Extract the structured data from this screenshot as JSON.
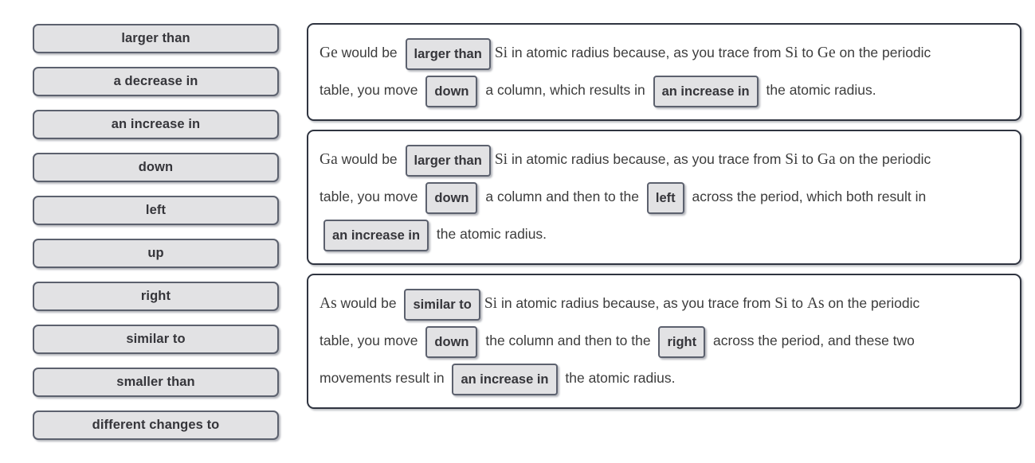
{
  "colors": {
    "page_background": "#ffffff",
    "tile_fill": "#e2e2e4",
    "tile_border": "#5c616e",
    "box_border": "#2f3440",
    "text": "#3c3c3c"
  },
  "word_bank": {
    "items": [
      {
        "label": "larger than"
      },
      {
        "label": "a decrease in"
      },
      {
        "label": "an increase in"
      },
      {
        "label": "down"
      },
      {
        "label": "left"
      },
      {
        "label": "up"
      },
      {
        "label": "right"
      },
      {
        "label": "similar to"
      },
      {
        "label": "smaller than"
      },
      {
        "label": "different changes to"
      }
    ]
  },
  "answers": [
    {
      "id": "answer-1",
      "lines": [
        {
          "parts": [
            {
              "type": "sym",
              "text": "Ge"
            },
            {
              "type": "text",
              "text": " would be "
            },
            {
              "type": "token",
              "text": "larger than"
            },
            {
              "type": "sym",
              "text": "Si"
            },
            {
              "type": "text",
              "text": " in atomic radius because, as you trace from "
            },
            {
              "type": "sym",
              "text": "Si"
            },
            {
              "type": "text",
              "text": " to "
            },
            {
              "type": "sym",
              "text": "Ge"
            },
            {
              "type": "text",
              "text": " on the periodic"
            }
          ]
        },
        {
          "parts": [
            {
              "type": "text",
              "text": "table, you move "
            },
            {
              "type": "token",
              "text": "down"
            },
            {
              "type": "text",
              "text": " a column, which results in "
            },
            {
              "type": "token",
              "text": "an increase in"
            },
            {
              "type": "text",
              "text": " the atomic radius."
            }
          ]
        }
      ]
    },
    {
      "id": "answer-2",
      "lines": [
        {
          "parts": [
            {
              "type": "sym",
              "text": "Ga"
            },
            {
              "type": "text",
              "text": " would be "
            },
            {
              "type": "token",
              "text": "larger than"
            },
            {
              "type": "sym",
              "text": "Si"
            },
            {
              "type": "text",
              "text": " in atomic radius because, as you trace from "
            },
            {
              "type": "sym",
              "text": "Si"
            },
            {
              "type": "text",
              "text": " to "
            },
            {
              "type": "sym",
              "text": "Ga"
            },
            {
              "type": "text",
              "text": " on the periodic"
            }
          ]
        },
        {
          "parts": [
            {
              "type": "text",
              "text": "table, you move "
            },
            {
              "type": "token",
              "text": "down"
            },
            {
              "type": "text",
              "text": " a column and then to the "
            },
            {
              "type": "token",
              "text": "left"
            },
            {
              "type": "text",
              "text": " across the period, which both result in"
            }
          ]
        },
        {
          "parts": [
            {
              "type": "token",
              "text": "an increase in"
            },
            {
              "type": "text",
              "text": " the atomic radius."
            }
          ]
        }
      ]
    },
    {
      "id": "answer-3",
      "lines": [
        {
          "parts": [
            {
              "type": "sym",
              "text": "As"
            },
            {
              "type": "text",
              "text": " would be "
            },
            {
              "type": "token",
              "text": "similar to"
            },
            {
              "type": "sym",
              "text": "Si"
            },
            {
              "type": "text",
              "text": " in atomic radius because, as you trace from "
            },
            {
              "type": "sym",
              "text": "Si"
            },
            {
              "type": "text",
              "text": " to "
            },
            {
              "type": "sym",
              "text": "As"
            },
            {
              "type": "text",
              "text": " on the periodic"
            }
          ]
        },
        {
          "parts": [
            {
              "type": "text",
              "text": "table, you move "
            },
            {
              "type": "token",
              "text": "down"
            },
            {
              "type": "text",
              "text": " the column and then to the "
            },
            {
              "type": "token",
              "text": "right"
            },
            {
              "type": "text",
              "text": " across the period, and these two"
            }
          ]
        },
        {
          "parts": [
            {
              "type": "text",
              "text": "movements result in "
            },
            {
              "type": "token",
              "text": "an increase in"
            },
            {
              "type": "text",
              "text": " the atomic radius."
            }
          ]
        }
      ]
    }
  ]
}
